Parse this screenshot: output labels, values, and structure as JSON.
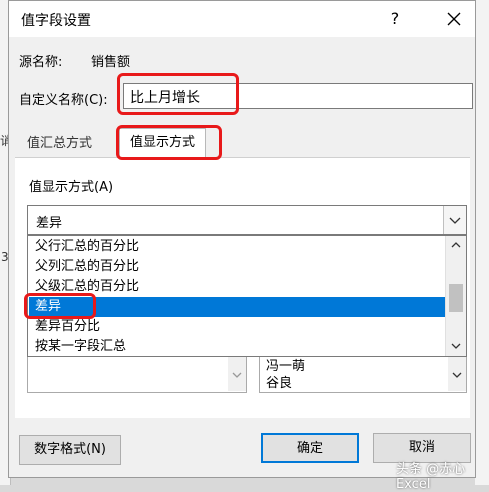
{
  "dialog": {
    "title": "值字段设置",
    "help": "?",
    "source_label": "源名称:",
    "source_value": "销售额",
    "custom_name_label": "自定义名称(C):",
    "custom_name_value": "比上月增长"
  },
  "tabs": [
    {
      "label": "值汇总方式",
      "active": false
    },
    {
      "label": "值显示方式",
      "active": true
    }
  ],
  "panel": {
    "show_as_label": "值显示方式(A)",
    "show_as_selected": "差异",
    "options": [
      {
        "label": "父行汇总的百分比",
        "selected": false
      },
      {
        "label": "父列汇总的百分比",
        "selected": false
      },
      {
        "label": "父级汇总的百分比",
        "selected": false
      },
      {
        "label": "差异",
        "selected": true
      },
      {
        "label": "差异百分比",
        "selected": false
      },
      {
        "label": "按某一字段汇总",
        "selected": false
      }
    ],
    "base_items": [
      "冯一萌",
      "谷良"
    ]
  },
  "buttons": {
    "number_format": "数字格式(N)",
    "ok": "确定",
    "cancel": "取消"
  },
  "background": {
    "left_glyph_1": "诮",
    "left_glyph_2": "3"
  },
  "watermark": "头条 @赤心Excel",
  "colors": {
    "accent": "#0078d7",
    "highlight_border": "#e8191a"
  }
}
